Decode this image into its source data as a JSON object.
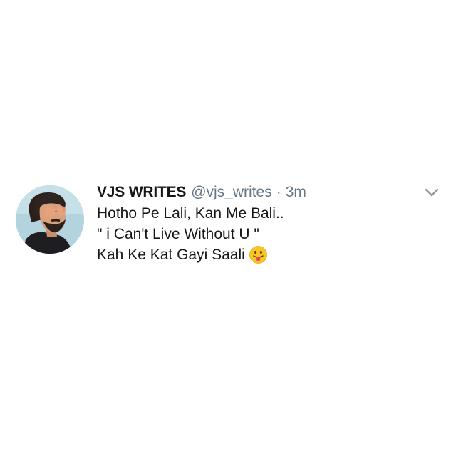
{
  "tweet": {
    "author": {
      "name": "VJS WRITES",
      "handle": "@vjs_writes"
    },
    "separator": "·",
    "time": "3m",
    "text_lines": [
      "Hotho Pe Lali, Kan Me Bali..",
      "\" i Can't Live Without U \"",
      "Kah Ke Kat Gayi Saali"
    ],
    "emoji": "face-with-tongue-emoji",
    "menu_icon": "chevron-down-icon"
  },
  "colors": {
    "background": "#ffffff",
    "text": "#14171a",
    "secondary_text": "#657786",
    "chevron": "#8899a6"
  }
}
